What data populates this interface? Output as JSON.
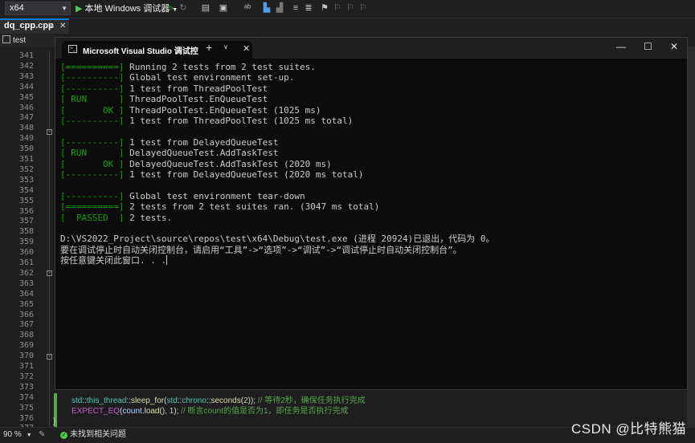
{
  "toolbar": {
    "platform": "x64",
    "run_label": "本地 Windows 调试器",
    "icons": [
      "play-outline-icon",
      "restart-icon",
      "folder-icon",
      "layout-icon",
      "spell-icon",
      "align-icon",
      "bookmark-icon",
      "bookmark-prev-icon",
      "bookmark-next-icon",
      "bookmark-clear-icon"
    ]
  },
  "editor": {
    "file_tab": "dq_cpp.cpp",
    "nav_scope": "test",
    "line_numbers": [
      "341",
      "342",
      "343",
      "344",
      "345",
      "346",
      "347",
      "348",
      "349",
      "350",
      "351",
      "352",
      "353",
      "354",
      "355",
      "356",
      "357",
      "358",
      "359",
      "360",
      "361",
      "362",
      "363",
      "364",
      "365",
      "366",
      "367",
      "368",
      "369",
      "370",
      "371",
      "372",
      "373",
      "374",
      "375",
      "376",
      "377"
    ],
    "code": {
      "line375": {
        "ns1": "std",
        "sep1": "::",
        "ns2": "this_thread",
        "sep2": "::",
        "fn": "sleep_for",
        "p1": "(",
        "ns3": "std",
        "sep3": "::",
        "ns4": "chrono",
        "sep4": "::",
        "fn2": "seconds",
        "p2": "(",
        "num": "2",
        "p3": "));",
        "cmt": " // 等待2秒，确保任务执行完成"
      },
      "line376": {
        "macro": "EXPECT_EQ",
        "p1": "(",
        "var": "count",
        "p2": ".",
        "fn": "load",
        "p3": "(), ",
        "num": "1",
        "p4": ");",
        "cmt": " // 断言count的值是否为1，即任务是否执行完成"
      },
      "line377": "}"
    }
  },
  "console": {
    "tab_title": "Microsoft Visual Studio 调试控",
    "lines": [
      {
        "tag": "[==========]",
        "text": " Running 2 tests from 2 test suites."
      },
      {
        "tag": "[----------]",
        "text": " Global test environment set-up."
      },
      {
        "tag": "[----------]",
        "text": " 1 test from ThreadPoolTest"
      },
      {
        "tag": "[ RUN      ]",
        "text": " ThreadPoolTest.EnQueueTest"
      },
      {
        "tag": "[       OK ]",
        "text": " ThreadPoolTest.EnQueueTest (1025 ms)"
      },
      {
        "tag": "[----------]",
        "text": " 1 test from ThreadPoolTest (1025 ms total)"
      },
      {
        "tag": "",
        "text": ""
      },
      {
        "tag": "[----------]",
        "text": " 1 test from DelayedQueueTest"
      },
      {
        "tag": "[ RUN      ]",
        "text": " DelayedQueueTest.AddTaskTest"
      },
      {
        "tag": "[       OK ]",
        "text": " DelayedQueueTest.AddTaskTest (2020 ms)"
      },
      {
        "tag": "[----------]",
        "text": " 1 test from DelayedQueueTest (2020 ms total)"
      },
      {
        "tag": "",
        "text": ""
      },
      {
        "tag": "[----------]",
        "text": " Global test environment tear-down"
      },
      {
        "tag": "[==========]",
        "text": " 2 tests from 2 test suites ran. (3047 ms total)"
      },
      {
        "tag": "[  PASSED  ]",
        "text": " 2 tests."
      },
      {
        "tag": "",
        "text": ""
      },
      {
        "tag": "",
        "text": "D:\\VS2022_Project\\source\\repos\\test\\x64\\Debug\\test.exe (进程 20924)已退出，代码为 0。"
      },
      {
        "tag": "",
        "text": "要在调试停止时自动关闭控制台，请启用“工具”->“选项”->“调试”->“调试停止时自动关闭控制台”。"
      },
      {
        "tag": "",
        "text": "按任意键关闭此窗口. . ."
      }
    ]
  },
  "statusbar": {
    "zoom": "90 %",
    "issues": "未找到相关问题"
  },
  "watermark": "CSDN @比特熊猫",
  "colors": {
    "console_green": "#13a10e",
    "accent": "#007acc",
    "console_bg": "#0c0c0c",
    "editor_bg": "#1e1e1e"
  }
}
